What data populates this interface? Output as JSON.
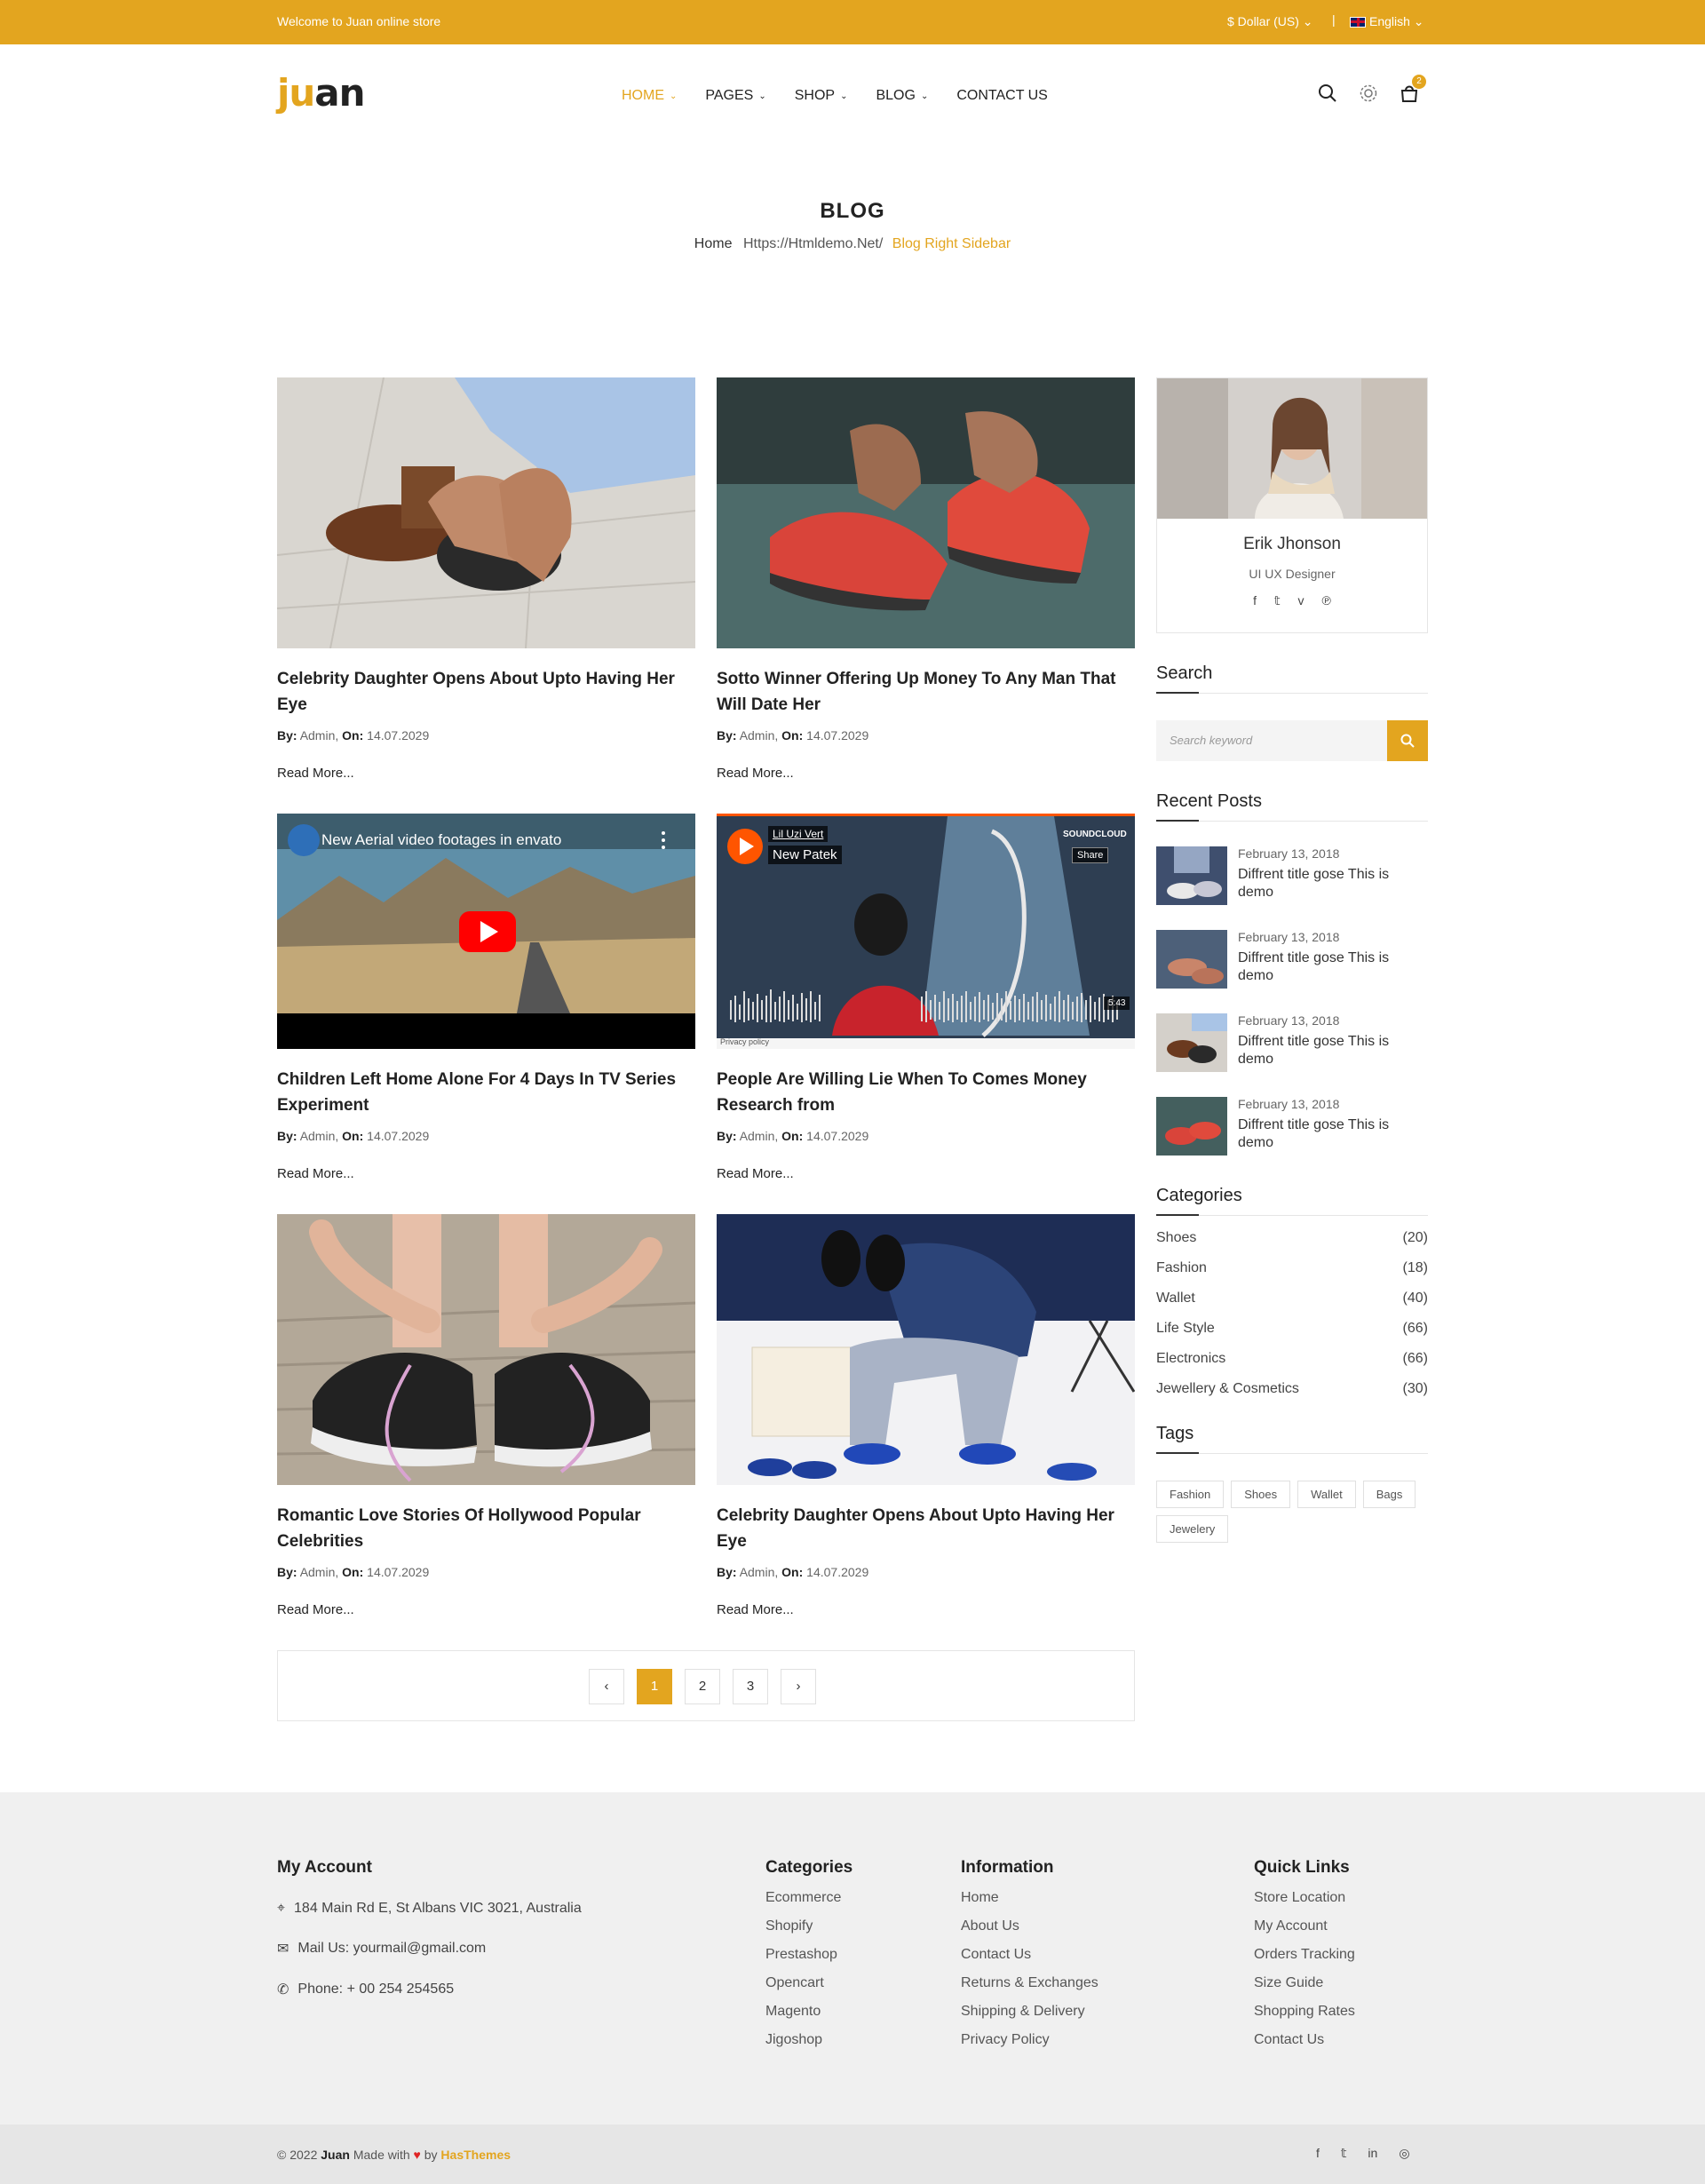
{
  "topbar": {
    "welcome": "Welcome to Juan online store",
    "currency": "$ Dollar (US) ⌄",
    "language": "English ⌄",
    "bg_color": "#e3a51f"
  },
  "header": {
    "logo_accent": "ju",
    "logo_rest": "an",
    "nav": [
      {
        "label": "HOME"
      },
      {
        "label": "PAGES"
      },
      {
        "label": "SHOP"
      },
      {
        "label": "BLOG"
      },
      {
        "label": "CONTACT US"
      }
    ],
    "cart_count": "2",
    "accent_color": "#e3a51f"
  },
  "breadcrumb": {
    "title": "BLOG",
    "home": "Home",
    "middle": "Https://Htmldemo.Net/",
    "current": "Blog Right Sidebar"
  },
  "posts": [
    {
      "title": "Celebrity Daughter Opens About Upto Having Her Eye",
      "by_label": "By:",
      "author": "Admin,",
      "on_label": "On:",
      "date": "14.07.2029",
      "more": "Read More..."
    },
    {
      "title": "Sotto Winner Offering Up Money To Any Man That Will Date Her",
      "by_label": "By:",
      "author": "Admin,",
      "on_label": "On:",
      "date": "14.07.2029",
      "more": "Read More..."
    },
    {
      "title": "Children Left Home Alone For 4 Days In TV Series Experiment",
      "by_label": "By:",
      "author": "Admin,",
      "on_label": "On:",
      "date": "14.07.2029",
      "more": "Read More...",
      "video_title": "New Aerial video footages in envato"
    },
    {
      "title": "People Are Willing Lie When To Comes Money Research from",
      "by_label": "By:",
      "author": "Admin,",
      "on_label": "On:",
      "date": "14.07.2029",
      "more": "Read More...",
      "sc_artist": "Lil Uzi Vert",
      "sc_track": "New Patek",
      "sc_brand": "SOUNDCLOUD",
      "sc_share": "Share",
      "sc_time": "5:43",
      "sc_privacy": "Privacy policy"
    },
    {
      "title": "Romantic Love Stories Of Hollywood Popular Celebrities",
      "by_label": "By:",
      "author": "Admin,",
      "on_label": "On:",
      "date": "14.07.2029",
      "more": "Read More..."
    },
    {
      "title": "Celebrity Daughter Opens About Upto Having Her Eye",
      "by_label": "By:",
      "author": "Admin,",
      "on_label": "On:",
      "date": "14.07.2029",
      "more": "Read More..."
    }
  ],
  "pagination": {
    "pages": [
      "1",
      "2",
      "3"
    ],
    "active": "1"
  },
  "sidebar": {
    "author": {
      "name": "Erik Jhonson",
      "role": "UI UX Designer"
    },
    "search": {
      "title": "Search",
      "placeholder": "Search keyword"
    },
    "recent": {
      "title": "Recent Posts",
      "items": [
        {
          "date": "February 13, 2018",
          "title": "Diffrent title gose This is demo"
        },
        {
          "date": "February 13, 2018",
          "title": "Diffrent title gose This is demo"
        },
        {
          "date": "February 13, 2018",
          "title": "Diffrent title gose This is demo"
        },
        {
          "date": "February 13, 2018",
          "title": "Diffrent title gose This is demo"
        }
      ]
    },
    "categories": {
      "title": "Categories",
      "items": [
        {
          "name": "Shoes",
          "count": "(20)"
        },
        {
          "name": "Fashion",
          "count": "(18)"
        },
        {
          "name": "Wallet",
          "count": "(40)"
        },
        {
          "name": "Life Style",
          "count": "(66)"
        },
        {
          "name": "Electronics",
          "count": "(66)"
        },
        {
          "name": "Jewellery & Cosmetics",
          "count": "(30)"
        }
      ]
    },
    "tags": {
      "title": "Tags",
      "items": [
        "Fashion",
        "Shoes",
        "Wallet",
        "Bags",
        "Jewelery"
      ]
    }
  },
  "footer": {
    "account": {
      "title": "My Account",
      "address": "184 Main Rd E, St Albans VIC 3021, Australia",
      "mail": "Mail Us: yourmail@gmail.com",
      "phone": "Phone: + 00 254 254565"
    },
    "categories": {
      "title": "Categories",
      "links": [
        "Ecommerce",
        "Shopify",
        "Prestashop",
        "Opencart",
        "Magento",
        "Jigoshop"
      ]
    },
    "information": {
      "title": "Information",
      "links": [
        "Home",
        "About Us",
        "Contact Us",
        "Returns & Exchanges",
        "Shipping & Delivery",
        "Privacy Policy"
      ]
    },
    "quick": {
      "title": "Quick Links",
      "links": [
        "Store Location",
        "My Account",
        "Orders Tracking",
        "Size Guide",
        "Shopping Rates",
        "Contact Us"
      ]
    },
    "copyright": {
      "prefix": "© 2022",
      "brand": "Juan",
      "made": "Made with",
      "by": "by",
      "company": "HasThemes"
    }
  }
}
